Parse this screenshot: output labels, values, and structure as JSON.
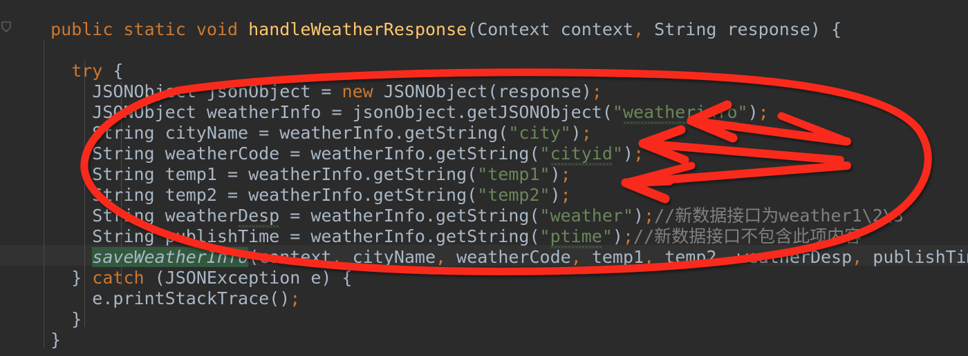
{
  "editor": {
    "theme_name": "darcula",
    "background_color": "#2b2b2b",
    "default_text_color": "#a9b7c6",
    "keyword_color": "#cc7832",
    "string_color": "#6a8759",
    "comment_color": "#808080",
    "method_name_color": "#ffc66d",
    "highlight_band_color": "#323232",
    "annotation_color": "#f92a1c",
    "language": "java",
    "font_size_px": 25,
    "line_height_px": 30
  },
  "gutter": {
    "icon": "shield-icon"
  },
  "code_lines": [
    {
      "indent": 2,
      "tokens": [
        {
          "text": "public",
          "type": "kw"
        },
        {
          "text": " ",
          "type": "plain"
        },
        {
          "text": "static",
          "type": "kw"
        },
        {
          "text": " ",
          "type": "plain"
        },
        {
          "text": "void",
          "type": "kw"
        },
        {
          "text": " ",
          "type": "plain"
        },
        {
          "text": "handleWeatherResponse",
          "type": "fn"
        },
        {
          "text": "(Context context",
          "type": "id"
        },
        {
          "text": ",",
          "type": "punc"
        },
        {
          "text": " String response) {",
          "type": "id"
        }
      ]
    },
    {
      "indent": 0,
      "tokens": []
    },
    {
      "indent": 4,
      "tokens": [
        {
          "text": "try",
          "type": "kw"
        },
        {
          "text": " {",
          "type": "id"
        }
      ]
    },
    {
      "indent": 6,
      "tokens": [
        {
          "text": "JSONObject jsonObject = ",
          "type": "id"
        },
        {
          "text": "new",
          "type": "kw"
        },
        {
          "text": " JSONObject(response)",
          "type": "id"
        },
        {
          "text": ";",
          "type": "punc"
        }
      ]
    },
    {
      "indent": 6,
      "tokens": [
        {
          "text": "JSONObject weatherInfo = jsonObject.getJSONObject(",
          "type": "id"
        },
        {
          "text": "\"weatherinfo\"",
          "type": "str",
          "typo": true
        },
        {
          "text": ")",
          "type": "id"
        },
        {
          "text": ";",
          "type": "punc"
        }
      ]
    },
    {
      "indent": 6,
      "tokens": [
        {
          "text": "String cityName = weatherInfo.getString(",
          "type": "id"
        },
        {
          "text": "\"city\"",
          "type": "str"
        },
        {
          "text": ")",
          "type": "id"
        },
        {
          "text": ";",
          "type": "punc"
        }
      ]
    },
    {
      "indent": 6,
      "tokens": [
        {
          "text": "String weatherCode = weatherInfo.getString(",
          "type": "id"
        },
        {
          "text": "\"cityid\"",
          "type": "str",
          "typo": true
        },
        {
          "text": ")",
          "type": "id"
        },
        {
          "text": ";",
          "type": "punc"
        }
      ]
    },
    {
      "indent": 6,
      "tokens": [
        {
          "text": "String temp1 = weatherInfo.getString(",
          "type": "id"
        },
        {
          "text": "\"temp1\"",
          "type": "str"
        },
        {
          "text": ")",
          "type": "id"
        },
        {
          "text": ";",
          "type": "punc"
        }
      ]
    },
    {
      "indent": 6,
      "tokens": [
        {
          "text": "String temp2 = weatherInfo.getString(",
          "type": "id"
        },
        {
          "text": "\"temp2\"",
          "type": "str"
        },
        {
          "text": ")",
          "type": "id"
        },
        {
          "text": ";",
          "type": "punc"
        }
      ]
    },
    {
      "indent": 6,
      "tokens": [
        {
          "text": "String weatherDesp",
          "type": "id",
          "typo_word": "Desp"
        },
        {
          "text": " = weatherInfo.getString(",
          "type": "id"
        },
        {
          "text": "\"weather\"",
          "type": "str"
        },
        {
          "text": ")",
          "type": "id"
        },
        {
          "text": ";",
          "type": "punc"
        },
        {
          "text": "//新数据接口为weather1\\2\\3",
          "type": "cmt"
        }
      ]
    },
    {
      "indent": 6,
      "tokens": [
        {
          "text": "String publishTime = weatherInfo.getString(",
          "type": "id"
        },
        {
          "text": "\"ptime\"",
          "type": "str",
          "typo": true
        },
        {
          "text": ")",
          "type": "id"
        },
        {
          "text": ";",
          "type": "punc"
        },
        {
          "text": "//新数据接口不包含此项内容",
          "type": "cmt"
        }
      ]
    },
    {
      "indent": 6,
      "highlighted": true,
      "tokens": [
        {
          "text": "saveWeatherInfo",
          "type": "meth",
          "usage_highlight": true
        },
        {
          "text": "(context",
          "type": "id"
        },
        {
          "text": ",",
          "type": "punc"
        },
        {
          "text": " cityName",
          "type": "id"
        },
        {
          "text": ",",
          "type": "punc"
        },
        {
          "text": " weatherCode",
          "type": "id"
        },
        {
          "text": ",",
          "type": "punc"
        },
        {
          "text": " temp1",
          "type": "id"
        },
        {
          "text": ",",
          "type": "punc"
        },
        {
          "text": " temp2",
          "type": "id"
        },
        {
          "text": ",",
          "type": "punc"
        },
        {
          "text": " weatherDesp",
          "type": "id"
        },
        {
          "text": ",",
          "type": "punc"
        },
        {
          "text": " publishTime)",
          "type": "id"
        },
        {
          "text": ";",
          "type": "punc"
        }
      ]
    },
    {
      "indent": 4,
      "tokens": [
        {
          "text": "} ",
          "type": "id"
        },
        {
          "text": "catch",
          "type": "kw"
        },
        {
          "text": " (JSONException e) {",
          "type": "id"
        }
      ]
    },
    {
      "indent": 6,
      "tokens": [
        {
          "text": "e.printStackTrace()",
          "type": "id"
        },
        {
          "text": ";",
          "type": "punc"
        }
      ]
    },
    {
      "indent": 4,
      "tokens": [
        {
          "text": "}",
          "type": "id"
        }
      ]
    },
    {
      "indent": 2,
      "tokens": [
        {
          "text": "}",
          "type": "id"
        }
      ]
    }
  ],
  "annotations": {
    "ellipse": {
      "shape": "hand-drawn-ellipse",
      "color": "#f92a1c",
      "stroke_width": 11,
      "encircles": "weatherInfo JSON field extraction block"
    },
    "arrows": [
      {
        "shape": "arrow-left",
        "color": "#f92a1c",
        "points_at": "weatherinfo / cityid string keys"
      },
      {
        "shape": "arrow-left",
        "color": "#f92a1c",
        "points_at": "temp1 string key"
      },
      {
        "shape": "arrow-left",
        "color": "#f92a1c",
        "points_at": "temp2 string key"
      }
    ]
  }
}
